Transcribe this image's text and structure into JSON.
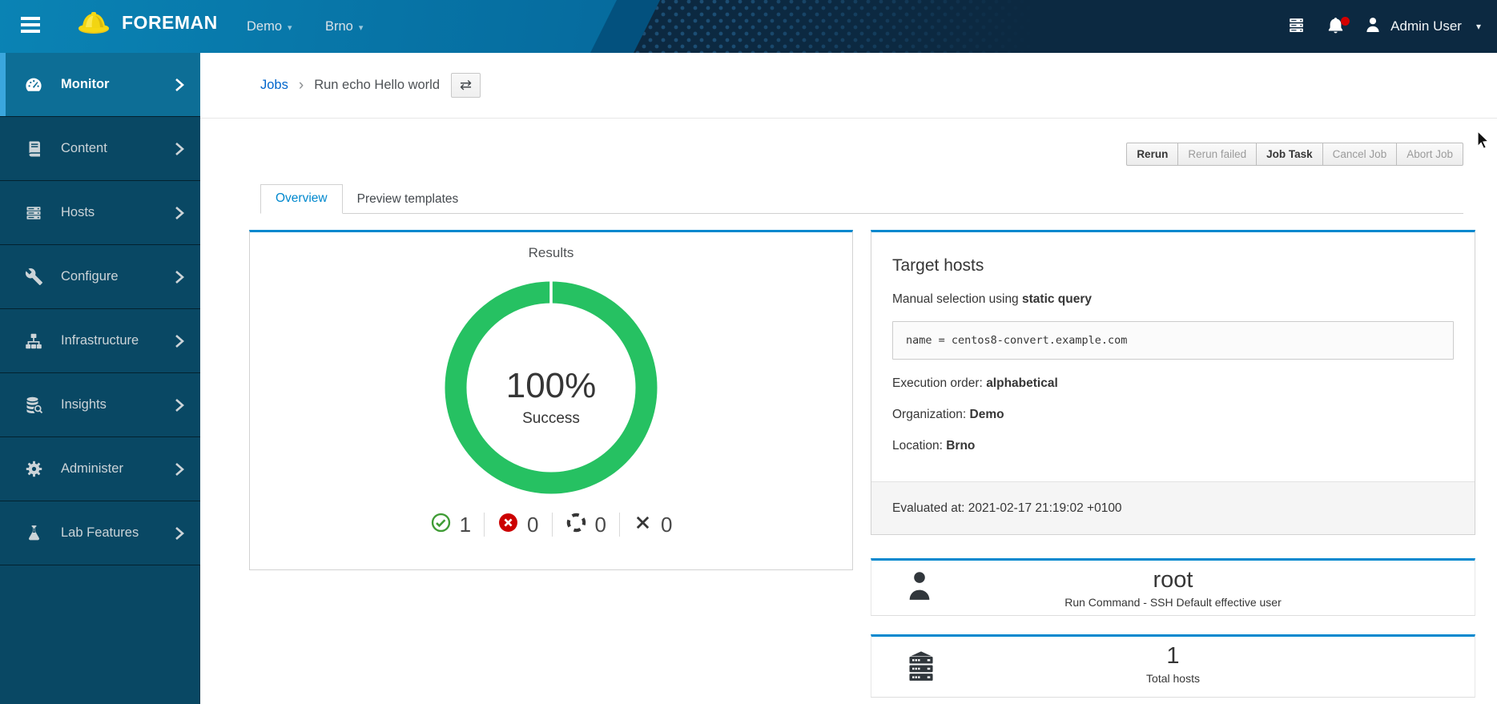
{
  "masthead": {
    "brand": "FOREMAN",
    "menus": [
      {
        "label": "Demo"
      },
      {
        "label": "Brno"
      }
    ],
    "caret": "▾",
    "user": {
      "name": "Admin User"
    }
  },
  "sidebar": {
    "items": [
      {
        "label": "Monitor",
        "icon": "monitor-gauge",
        "active": true
      },
      {
        "label": "Content",
        "icon": "book",
        "active": false
      },
      {
        "label": "Hosts",
        "icon": "server-stack",
        "active": false
      },
      {
        "label": "Configure",
        "icon": "wrench",
        "active": false
      },
      {
        "label": "Infrastructure",
        "icon": "sitemap",
        "active": false
      },
      {
        "label": "Insights",
        "icon": "database-search",
        "active": false
      },
      {
        "label": "Administer",
        "icon": "gear",
        "active": false
      },
      {
        "label": "Lab Features",
        "icon": "flask",
        "active": false
      }
    ]
  },
  "breadcrumb": {
    "link": "Jobs",
    "separator": "›",
    "current": "Run echo Hello world",
    "swap_icon": "⇄"
  },
  "actions": {
    "buttons": [
      {
        "label": "Rerun",
        "enabled": true
      },
      {
        "label": "Rerun failed",
        "enabled": false
      },
      {
        "label": "Job Task",
        "enabled": true
      },
      {
        "label": "Cancel Job",
        "enabled": false
      },
      {
        "label": "Abort Job",
        "enabled": false
      }
    ]
  },
  "tabs": {
    "overview": "Overview",
    "preview": "Preview templates"
  },
  "results": {
    "title": "Results",
    "percent": "100%",
    "status": "Success",
    "legend": {
      "success": "1",
      "failed": "0",
      "pending": "0",
      "cancelled": "0"
    }
  },
  "target_hosts": {
    "title": "Target hosts",
    "selection_prefix": "Manual selection using ",
    "selection_mode": "static query",
    "query": "name = centos8-convert.example.com",
    "execution_order_label": "Execution order: ",
    "execution_order_value": "alphabetical",
    "organization_label": "Organization: ",
    "organization_value": "Demo",
    "location_label": "Location: ",
    "location_value": "Brno",
    "evaluated_text": "Evaluated at: 2021-02-17 21:19:02 +0100"
  },
  "effective_user": {
    "name": "root",
    "description": "Run Command - SSH Default effective user"
  },
  "total_hosts": {
    "count": "1",
    "label": "Total hosts"
  },
  "chart_data": {
    "type": "pie",
    "donut": true,
    "title": "Results",
    "categories": [
      "Success",
      "Failed",
      "Pending",
      "Cancelled"
    ],
    "values": [
      1,
      0,
      0,
      0
    ],
    "percent_label": "100%",
    "percent_sublabel": "Success",
    "colors": {
      "success": "#26c162",
      "failed": "#cc0000",
      "pending": "#363636",
      "cancelled": "#363636"
    },
    "legend_position": "bottom"
  },
  "colors": {
    "accent_blue": "#0088ce",
    "masthead_left": "#0a83b4",
    "masthead_dark": "#0c2941",
    "sidebar_bg": "#094864",
    "sidebar_active_bg": "#0d6e96",
    "sidebar_accent": "#3aa6dd",
    "donut_green": "#26c162",
    "notification_red": "#d30000"
  }
}
